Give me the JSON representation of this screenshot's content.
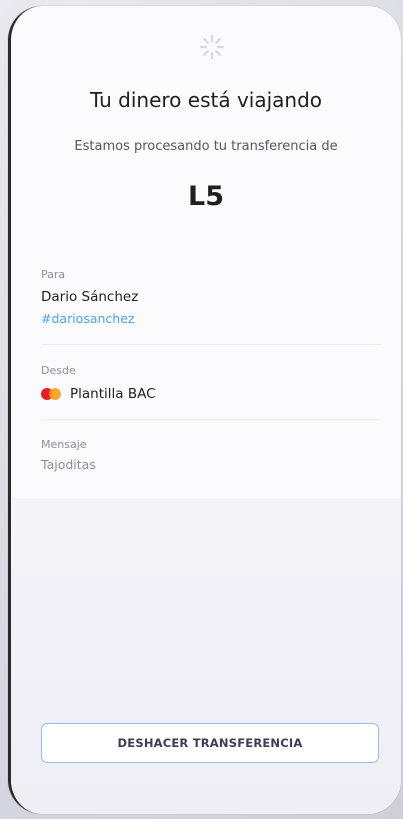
{
  "header": {
    "spinner_icon": "loading-spinner-icon",
    "title": "Tu dinero está viajando",
    "subtitle": "Estamos procesando tu transferencia de",
    "amount": "L5"
  },
  "recipient": {
    "label": "Para",
    "name": "Dario Sánchez",
    "handle": "#dariosanchez"
  },
  "source": {
    "label": "Desde",
    "card_icon": "mastercard-icon",
    "card_name": "Plantilla BAC"
  },
  "message": {
    "label": "Mensaje",
    "text": "Tajoditas"
  },
  "actions": {
    "undo_label": "DESHACER TRANSFERENCIA"
  },
  "colors": {
    "accent": "#4ea3e8",
    "button_border": "#8ec2ea",
    "mastercard_red": "#eb1c26",
    "mastercard_orange": "#f79e1b"
  }
}
